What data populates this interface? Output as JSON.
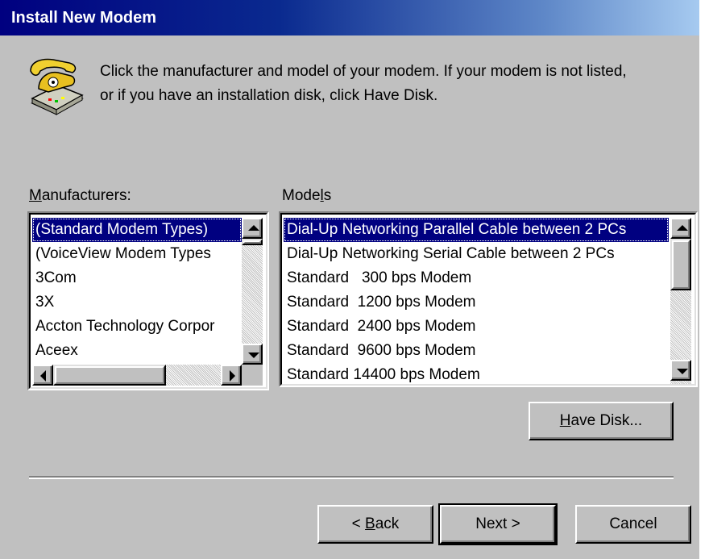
{
  "window": {
    "title": "Install New Modem"
  },
  "instructions": {
    "line1": "Click the manufacturer and model of your modem. If your modem is not listed,",
    "line2": "or if you have an installation disk, click Have Disk."
  },
  "manufacturers": {
    "label_prefix": "",
    "label_mnemonic": "M",
    "label_rest": "anufacturers:",
    "items": [
      "(Standard Modem Types)",
      "(VoiceView Modem Types",
      "3Com",
      "3X",
      "Accton Technology Corpor",
      "Aceex"
    ],
    "selected_index": 0
  },
  "models": {
    "label_prefix": "Mode",
    "label_mnemonic": "l",
    "label_rest": "s",
    "items": [
      "Dial-Up Networking Parallel Cable between 2 PCs",
      "Dial-Up Networking Serial Cable between 2 PCs",
      "Standard   300 bps Modem",
      "Standard  1200 bps Modem",
      "Standard  2400 bps Modem",
      "Standard  9600 bps Modem",
      "Standard 14400 bps Modem"
    ],
    "selected_index": 0
  },
  "buttons": {
    "have_disk": {
      "mnemonic": "H",
      "rest": "ave Disk..."
    },
    "back": {
      "prefix": "< ",
      "mnemonic": "B",
      "rest": "ack"
    },
    "next": "Next >",
    "cancel": "Cancel"
  },
  "colors": {
    "selection": "#000080",
    "face": "#c0c0c0",
    "titlebar_start": "#000080",
    "titlebar_end": "#a6caf0"
  },
  "icons": {
    "wizard": "telephone-modem-icon"
  }
}
